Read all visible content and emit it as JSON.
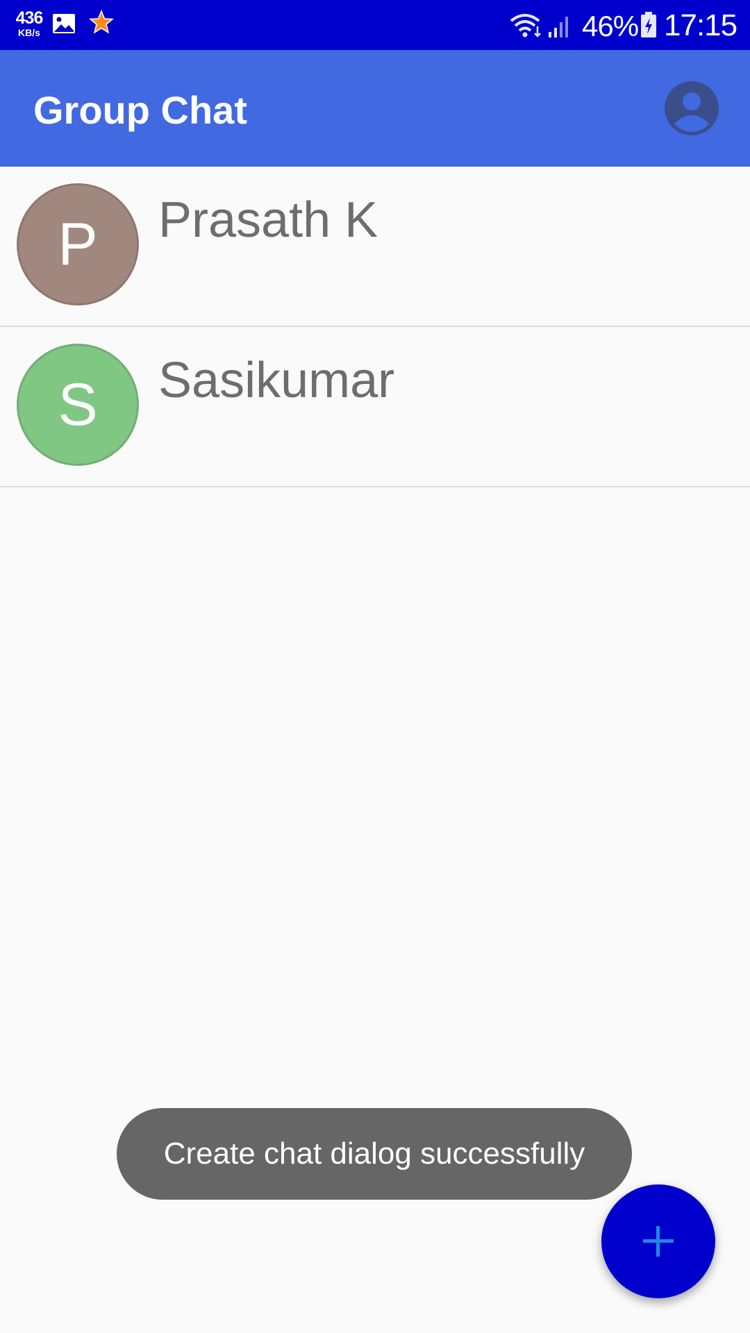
{
  "status_bar": {
    "speed_value": "436",
    "speed_unit": "KB/s",
    "battery": "46%",
    "time": "17:15",
    "icons": [
      "image-icon",
      "star-icon",
      "wifi-icon",
      "signal-icon",
      "battery-icon"
    ]
  },
  "app_bar": {
    "title": "Group Chat",
    "profile_icon": "account-circle-icon"
  },
  "chats": [
    {
      "initial": "P",
      "name": "Prasath K",
      "color": "#a1887f"
    },
    {
      "initial": "S",
      "name": "Sasikumar",
      "color": "#81c784"
    }
  ],
  "toast": {
    "message": "Create chat dialog successfully"
  },
  "fab": {
    "icon": "plus-icon"
  },
  "colors": {
    "status_bar": "#0000cc",
    "app_bar": "#4169e1",
    "fab": "#0000cc",
    "fab_icon": "#1e88e5",
    "profile_icon": "#3a4e8c",
    "toast": "#666666"
  }
}
